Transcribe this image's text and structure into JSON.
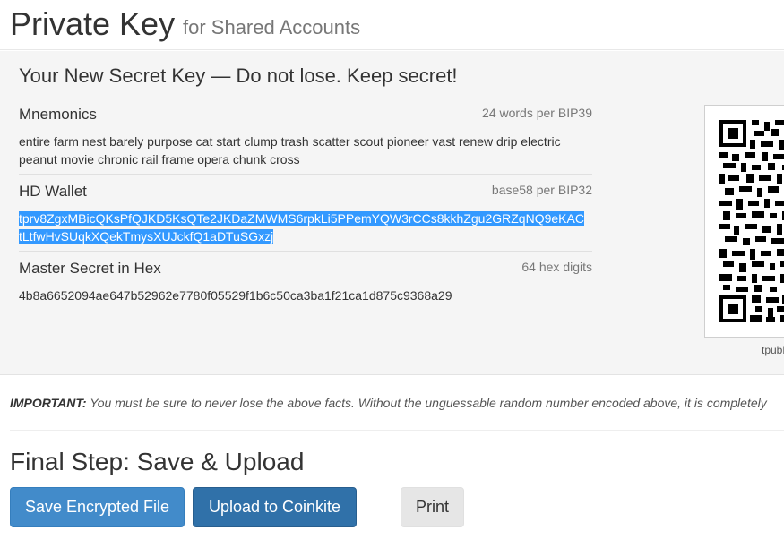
{
  "header": {
    "title": "Private Key",
    "subtitle": "for Shared Accounts"
  },
  "secret": {
    "heading": "Your New Secret Key — Do not lose. Keep secret!",
    "mnemonics": {
      "label": "Mnemonics",
      "hint": "24 words per BIP39",
      "value_line1": "entire farm nest barely purpose cat start clump trash scatter scout pioneer vast renew drip electric",
      "value_line2": "peanut movie chronic rail frame opera chunk cross"
    },
    "hd_wallet": {
      "label": "HD Wallet",
      "hint": "base58 per BIP32",
      "value_line1": "tprv8ZgxMBicQKsPfQJKD5KsQTe2JKDaZMWMS6rpkLi5PPemYQW3rCCs8kkhZgu2GRZqNQ9eKAC",
      "value_line2": "tLtfwHvSUqkXQekTmysXUJckfQ1aDTuSGxzj"
    },
    "master_secret": {
      "label": "Master Secret in Hex",
      "hint": "64 hex digits",
      "value": "4b8a6652094ae647b52962e7780f05529f1b6c50ca3ba1f21ca1d875c9368a29"
    },
    "qr_caption": "tpubD"
  },
  "important": {
    "label": "IMPORTANT:",
    "text": "You must be sure to never lose the above facts. Without the unguessable random number encoded above, it is completely"
  },
  "final_step": {
    "heading": "Final Step: Save & Upload",
    "save_label": "Save Encrypted File",
    "upload_label": "Upload to Coinkite",
    "print_label": "Print"
  },
  "colors": {
    "primary": "#428bca",
    "primary_active": "#3071a9",
    "selection": "#3399ff"
  }
}
